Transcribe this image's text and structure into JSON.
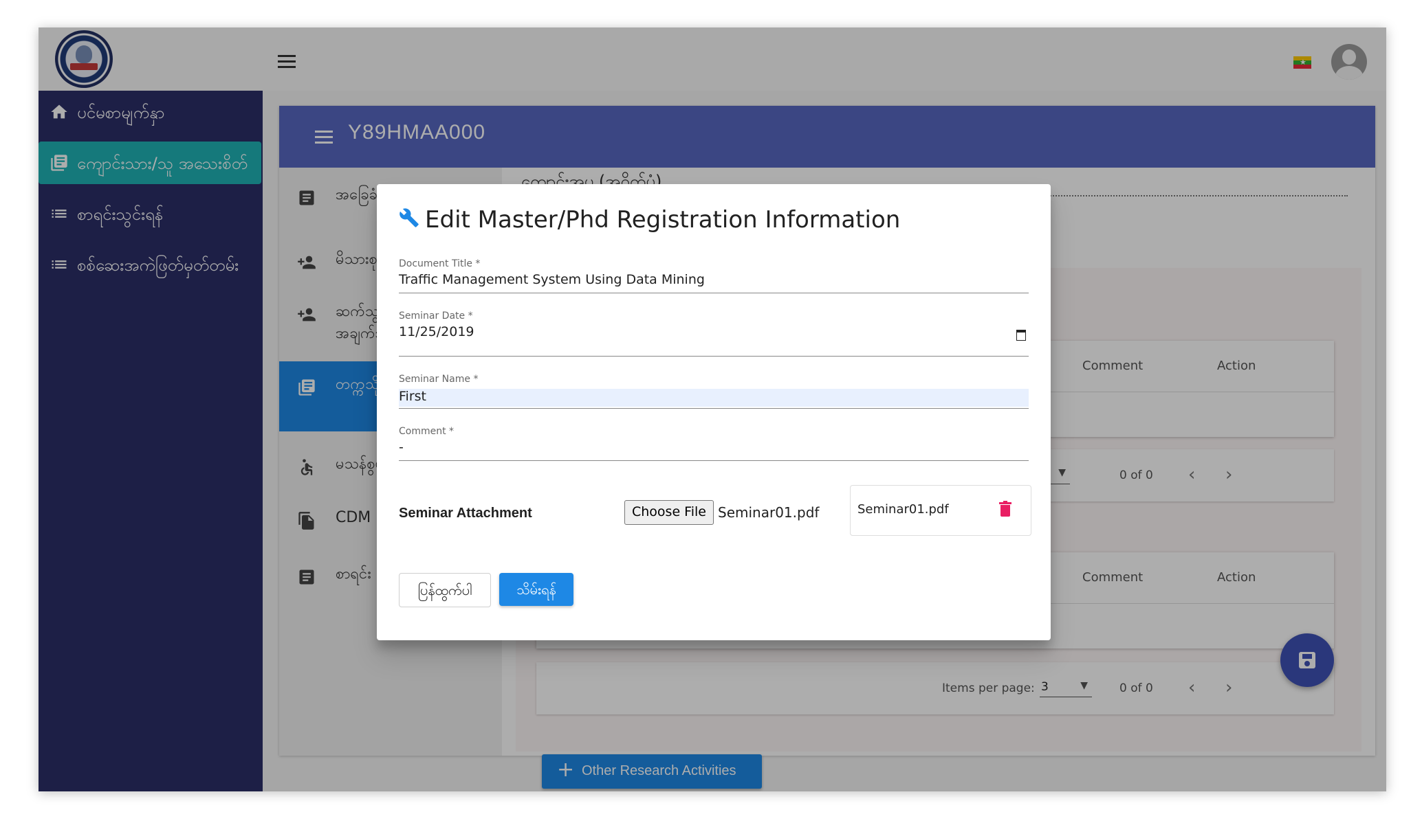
{
  "app": {
    "logo_icon": "university-seal-logo",
    "menu_icon": "hamburger-menu-icon",
    "flag_icon": "myanmar-flag-icon",
    "avatar_icon": "user-avatar-icon",
    "colors": {
      "sidebar": "#2c2e67",
      "active_teal": "#1fb3b5",
      "primary": "#1e88e5",
      "header_indigo": "#5868c1",
      "danger": "#e91e63"
    }
  },
  "sidebar": {
    "items": [
      {
        "label": "ပင်မစာမျက်နှာ",
        "icon": "home-icon"
      },
      {
        "label": "ကျောင်းသား/သူ အသေးစိတ်",
        "icon": "article-icon",
        "active": true
      },
      {
        "label": "စာရင်းသွင်းရန်",
        "icon": "list-icon"
      },
      {
        "label": "စစ်ဆေးအကဲဖြတ်မှတ်တမ်း",
        "icon": "list-icon"
      }
    ]
  },
  "card": {
    "title": "Y89HMAA000",
    "nav": [
      {
        "label": "အခြေခံ အချက်အလက် များ",
        "icon": "article-icon"
      },
      {
        "label": "မိသားစု",
        "icon": "person-add-icon"
      },
      {
        "label": "ဆက်သွယ်ရန် အချက်အလက်",
        "icon": "person-add-icon"
      },
      {
        "label": "တက္ကသိုလ် ကျောင်းသား",
        "icon": "article-icon",
        "active": true
      },
      {
        "label": "မသန်စွမ်း",
        "icon": "accessibility-icon"
      },
      {
        "label": "CDM",
        "icon": "documents-icon"
      },
      {
        "label": "စာရင်း",
        "icon": "article-icon"
      }
    ],
    "breadcrumb": "ကျောင်းအပ (အဝိုက်ပုံ)"
  },
  "tables": [
    {
      "headers": [
        "Comment",
        "Action"
      ],
      "pager": {
        "range": "0 of 0"
      }
    },
    {
      "headers": [
        "Comment",
        "Action"
      ],
      "pager": {
        "items_per_page_label": "Items per page:",
        "items_per_page": "3",
        "range": "0 of 0"
      }
    }
  ],
  "add_button": {
    "label": "Other Research Activities",
    "icon": "plus-icon"
  },
  "fab": {
    "icon": "save-icon"
  },
  "dialog": {
    "title": "Edit Master/Phd Registration Information",
    "title_icon": "tools-icon",
    "fields": {
      "document_title": {
        "label": "Document Title *",
        "value": "Traffic Management System Using Data Mining"
      },
      "seminar_date": {
        "label": "Seminar Date *",
        "value": "11/25/2019"
      },
      "seminar_name": {
        "label": "Seminar Name *",
        "value": "First"
      },
      "comment": {
        "label": "Comment *",
        "value": "-"
      }
    },
    "attachment": {
      "label": "Seminar Attachment",
      "choose_button": "Choose File",
      "chosen_file": "Seminar01.pdf",
      "uploaded_file": "Seminar01.pdf",
      "delete_icon": "trash-icon"
    },
    "buttons": {
      "cancel": "ပြန်ထွက်ပါ",
      "save": "သိမ်းရန်"
    }
  }
}
